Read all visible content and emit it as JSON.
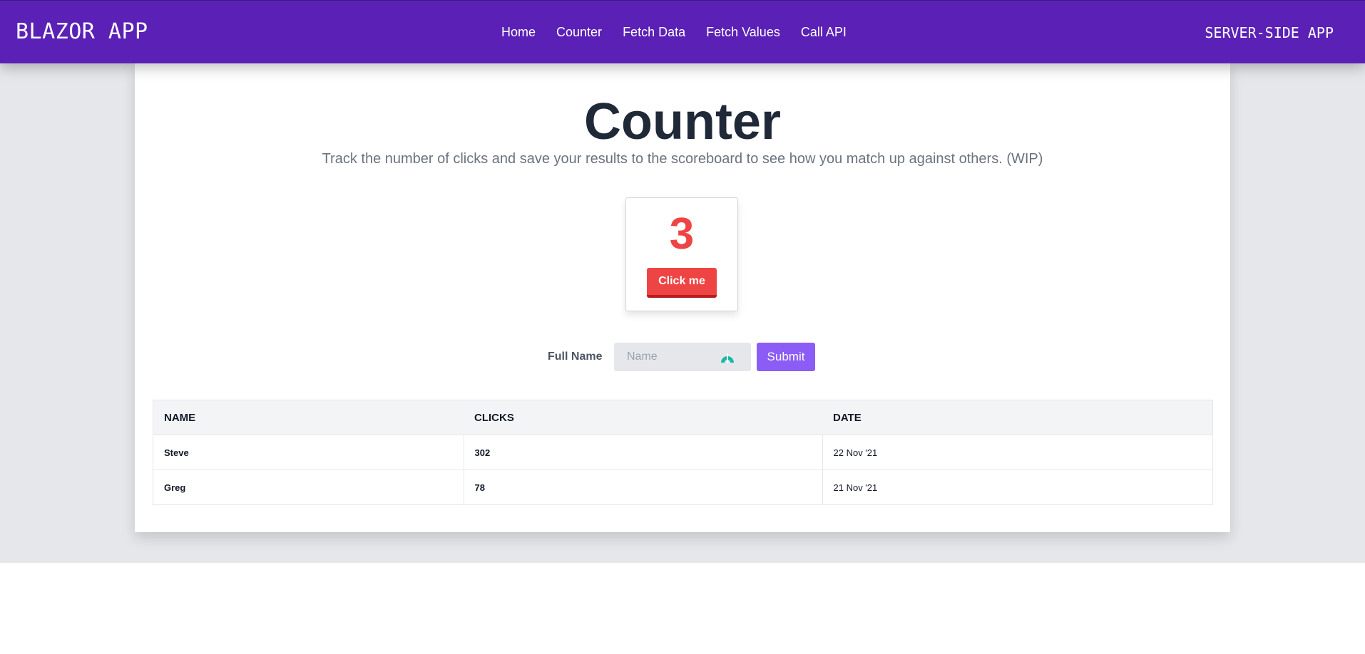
{
  "nav": {
    "brand": "BLAZOR APP",
    "links": [
      "Home",
      "Counter",
      "Fetch Data",
      "Fetch Values",
      "Call API"
    ],
    "right_label": "SERVER-SIDE APP"
  },
  "page": {
    "title": "Counter",
    "subtitle": "Track the number of clicks and save your results to the scoreboard to see how you match up against others. (WIP)"
  },
  "counter": {
    "value": "3",
    "button_label": "Click me"
  },
  "form": {
    "label": "Full Name",
    "input_value": "",
    "input_placeholder": "Name",
    "submit_label": "Submit",
    "field_badge_icon": "password-manager-icon"
  },
  "scoreboard": {
    "headers": [
      "NAME",
      "CLICKS",
      "DATE"
    ],
    "rows": [
      {
        "name": "Steve",
        "clicks": "302",
        "date": "22 Nov '21"
      },
      {
        "name": "Greg",
        "clicks": "78",
        "date": "21 Nov '21"
      }
    ]
  },
  "colors": {
    "navbar": "#5b21b6",
    "counter_accent": "#ef4444",
    "submit": "#8b5cf6",
    "page_background": "#e5e7eb"
  }
}
